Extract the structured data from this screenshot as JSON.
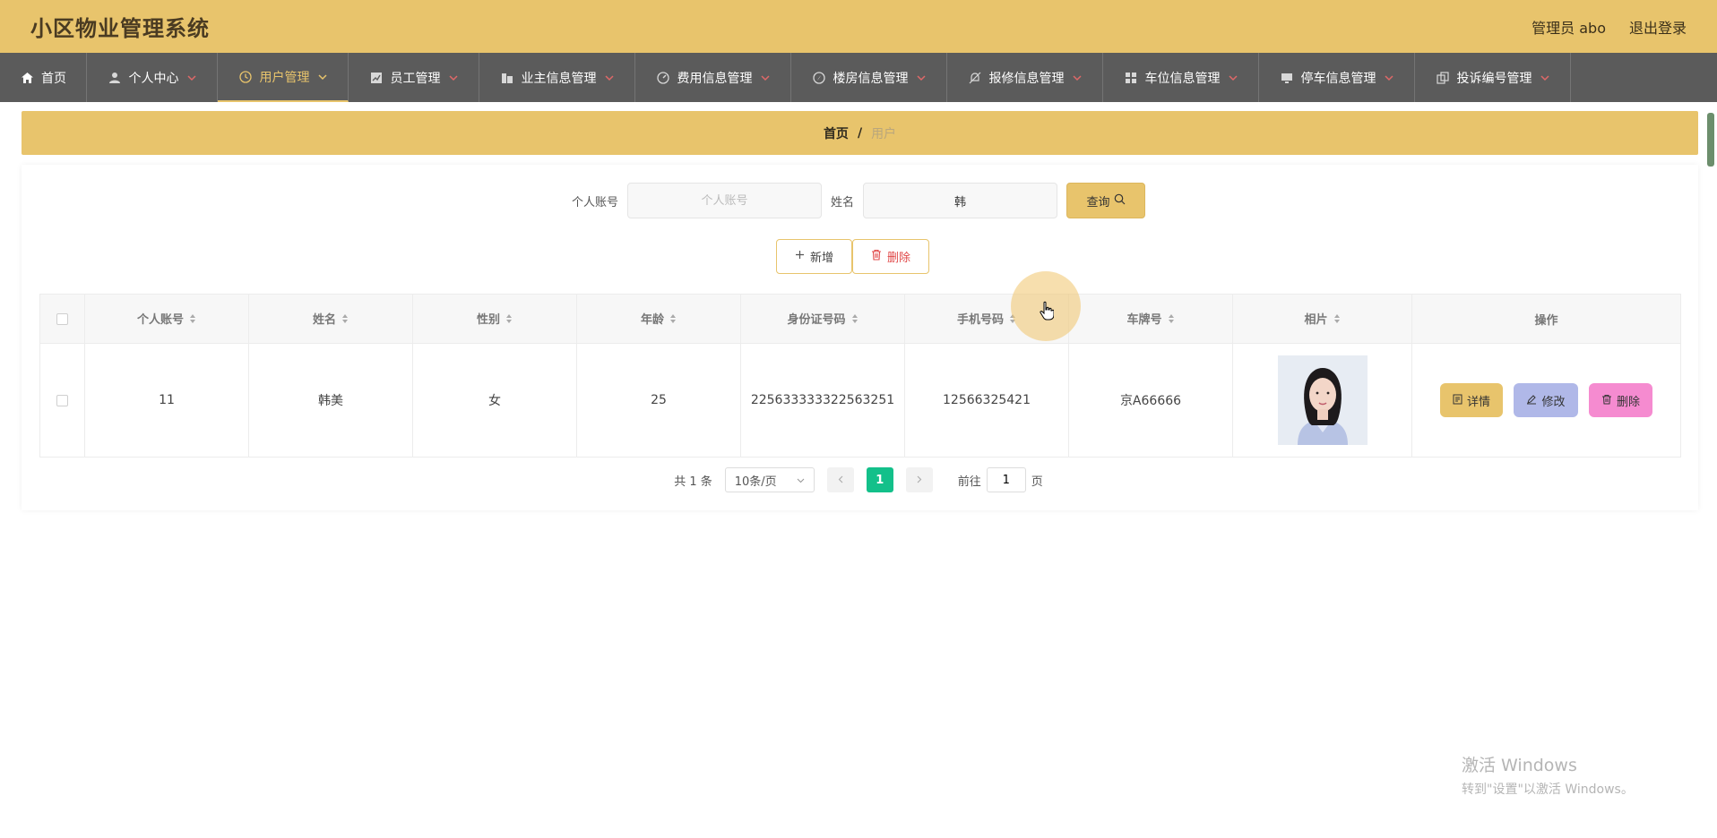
{
  "header": {
    "title": "小区物业管理系统",
    "admin_label": "管理员 abo",
    "logout_label": "退出登录"
  },
  "nav": {
    "items": [
      {
        "label": "首页",
        "icon": "home-icon"
      },
      {
        "label": "个人中心",
        "icon": "user-icon"
      },
      {
        "label": "用户管理",
        "icon": "clock-icon",
        "active": true
      },
      {
        "label": "员工管理",
        "icon": "chart-icon"
      },
      {
        "label": "业主信息管理",
        "icon": "building-icon"
      },
      {
        "label": "费用信息管理",
        "icon": "gauge-icon"
      },
      {
        "label": "楼房信息管理",
        "icon": "compass-icon"
      },
      {
        "label": "报修信息管理",
        "icon": "bell-off-icon"
      },
      {
        "label": "车位信息管理",
        "icon": "grid-icon"
      },
      {
        "label": "停车信息管理",
        "icon": "monitor-icon"
      },
      {
        "label": "投诉编号管理",
        "icon": "copy-icon"
      }
    ]
  },
  "breadcrumb": {
    "home": "首页",
    "separator": "/",
    "current": "用户"
  },
  "search": {
    "account_label": "个人账号",
    "account_placeholder": "个人账号",
    "account_value": "",
    "name_label": "姓名",
    "name_value": "韩",
    "query_label": "查询"
  },
  "actions": {
    "add_label": "新增",
    "delete_label": "删除"
  },
  "table": {
    "columns": [
      "个人账号",
      "姓名",
      "性别",
      "年龄",
      "身份证号码",
      "手机号码",
      "车牌号",
      "相片",
      "操作"
    ],
    "rows": [
      {
        "account": "11",
        "name": "韩美",
        "gender": "女",
        "age": "25",
        "id_number": "225633333322563251",
        "phone": "12566325421",
        "plate": "京A66666"
      }
    ],
    "ops": {
      "detail": "详情",
      "edit": "修改",
      "delete": "删除"
    }
  },
  "pagination": {
    "total": "共 1 条",
    "page_size": "10条/页",
    "current_page": "1",
    "goto_label": "前往",
    "goto_value": "1",
    "page_suffix": "页"
  },
  "watermark": {
    "line1": "激活 Windows",
    "line2": "转到\"设置\"以激活 Windows。"
  },
  "colors": {
    "brand": "#e8c46c",
    "nav_bg": "#5b5b5b",
    "page_active": "#13c08a"
  }
}
